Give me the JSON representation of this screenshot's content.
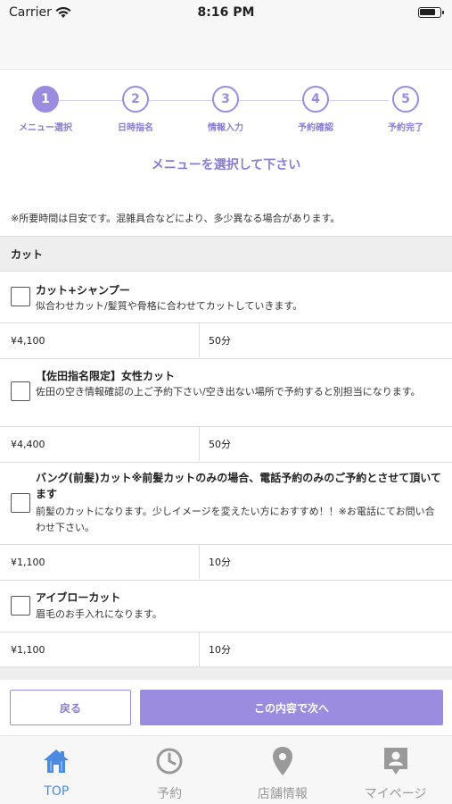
{
  "status_bar": {
    "carrier": "Carrier",
    "time": "8:16 PM"
  },
  "steps": [
    {
      "number": "1",
      "label": "メニュー選択",
      "active": true
    },
    {
      "number": "2",
      "label": "日時指名",
      "active": false
    },
    {
      "number": "3",
      "label": "情報入力",
      "active": false
    },
    {
      "number": "4",
      "label": "予約確認",
      "active": false
    },
    {
      "number": "5",
      "label": "予約完了",
      "active": false
    }
  ],
  "page_title": "メニューを選択して下さい",
  "notice": "※所要時間は目安です。混雑具合などにより、多少異なる場合があります。",
  "section": {
    "title": "カット"
  },
  "menu_items": [
    {
      "name": "カット+シャンプー",
      "description": "似合わせカット/髪質や骨格に合わせてカットしていきます。",
      "price": "¥4,100",
      "duration": "50分"
    },
    {
      "name": "【佐田指名限定】女性カット",
      "description": "佐田の空き情報確認の上ご予約下さい/空き出ない場所で予約すると別担当になります。",
      "price": "¥4,400",
      "duration": "50分"
    },
    {
      "name": "バング(前髪)カット※前髪カットのみの場合、電話予約のみのご予約とさせて頂いてます",
      "description": "前髪のカットになります。少しイメージを変えたい方におすすめ！！※お電話にてお問い合わせ下さい。",
      "price": "¥1,100",
      "duration": "10分"
    },
    {
      "name": "アイブローカット",
      "description": "眉毛のお手入れになります。",
      "price": "¥1,100",
      "duration": "10分"
    }
  ],
  "buttons": {
    "back": "戻る",
    "next": "この内容で次へ"
  },
  "tabs": [
    {
      "label": "TOP",
      "icon": "home-icon",
      "active": true
    },
    {
      "label": "予約",
      "icon": "clock-icon",
      "active": false
    },
    {
      "label": "店舗情報",
      "icon": "map-pin-icon",
      "active": false
    },
    {
      "label": "マイページ",
      "icon": "person-badge-icon",
      "active": false
    }
  ],
  "colors": {
    "accent": "#9b8cdf",
    "tab_active": "#4a8be0",
    "tab_inactive": "#999999"
  }
}
